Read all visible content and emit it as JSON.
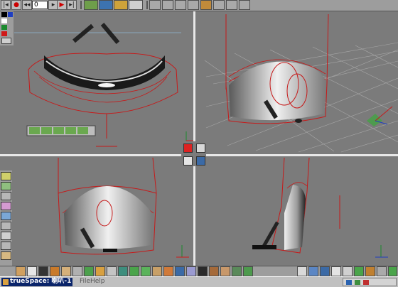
{
  "app": {
    "taskbar_title": "trueSpace: 喇叭-1",
    "menu_file": "File",
    "menu_help": "Help",
    "frame_counter": "0"
  },
  "colors": {
    "viewport_bg": "#7b7b7b",
    "wire": "#c61a1a",
    "separator": "#e8e8e8",
    "taskbar_bg": "#c0c0c0",
    "taskbar_active": "#0a246a"
  },
  "top_toolbar": [
    "playback-first-icon",
    "record-icon",
    "rewind-icon",
    "frame-field",
    "next-frame-icon",
    "play-icon",
    "last-frame-icon",
    "object-tool-icon",
    "paint-icon",
    "undo-icon",
    "redo-icon",
    "select-icon",
    "move-icon",
    "rotate-icon",
    "scale-icon",
    "sweep-icon",
    "glue-icon",
    "lathe-icon",
    "erase-icon",
    "copy-icon",
    "unglue-icon",
    "materials-icon"
  ],
  "bottom_toolbar": [
    "sphere-icon",
    "cube-icon",
    "cylinder-icon",
    "cone-icon",
    "torus-icon",
    "plane-icon",
    "light-icon",
    "camera-icon",
    "texture-icon",
    "material-icon",
    "render-icon",
    "animation-icon",
    "figure-icon",
    "particles-icon",
    "deform-icon",
    "nurbs-icon",
    "boolean-icon",
    "group-icon",
    "face-icon",
    "grid-icon",
    "snap-icon",
    "help-icon",
    "script-icon",
    "display-icon"
  ],
  "left_palette": [
    "color-swatch-black",
    "color-swatch-blue",
    "color-swatch-green",
    "color-swatch-red",
    "color-swatch-grey",
    "grid-snap-icon"
  ],
  "left_palette_lower": [
    "layer-icon",
    "texture-map-icon",
    "uv-icon",
    "shade-icon",
    "smooth-icon",
    "render-obj-icon",
    "scene-icon",
    "paint-face-icon",
    "bend-icon"
  ],
  "spline_toolbar": [
    "curve-a-icon",
    "curve-b-icon",
    "curve-c-icon",
    "curve-d-icon",
    "curve-e-icon"
  ]
}
